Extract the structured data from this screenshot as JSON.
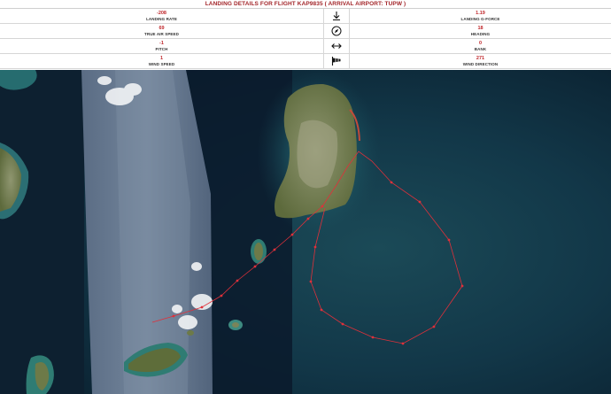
{
  "header": {
    "title": "LANDING DETAILS FOR FLIGHT KAP9835 ( ARRIVAL AIRPORT: TUPW )"
  },
  "stats": [
    {
      "left_value": "-208",
      "left_label": "LANDING RATE",
      "icon": "arrow-down-to-line-icon",
      "right_value": "1.19",
      "right_label": "LANDING G-FORCE"
    },
    {
      "left_value": "69",
      "left_label": "TRUE AIR SPEED",
      "icon": "compass-icon",
      "right_value": "18",
      "right_label": "HEADING"
    },
    {
      "left_value": "-1",
      "left_label": "PITCH",
      "icon": "left-right-arrow-icon",
      "right_value": "0",
      "right_label": "BANK"
    },
    {
      "left_value": "1",
      "left_label": "WIND SPEED",
      "icon": "windsock-icon",
      "right_value": "271",
      "right_label": "WIND DIRECTION"
    }
  ],
  "colors": {
    "accent": "#a3262a",
    "flight_path": "#e0303a",
    "ocean_deep": "#0c2434",
    "ocean_shallow": "#1f5a66"
  }
}
